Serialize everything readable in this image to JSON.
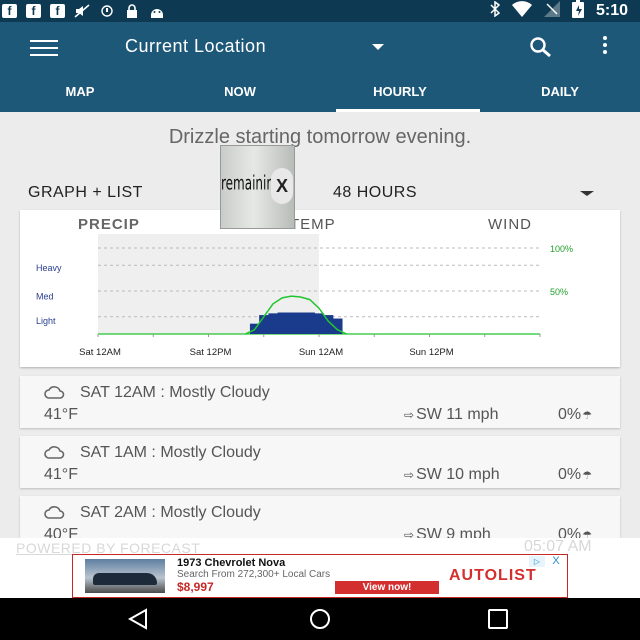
{
  "status_bar": {
    "time": "5:10",
    "left_icons": [
      "facebook-icon",
      "facebook-icon",
      "facebook-icon",
      "no-sound-icon",
      "sync-icon",
      "lock-icon",
      "android-debug-icon"
    ],
    "right_icons": [
      "bluetooth-icon",
      "wifi-icon",
      "signal-icon",
      "battery-charging-icon"
    ],
    "fb_letter": "f"
  },
  "app_bar": {
    "title": "Current Location",
    "tabs": [
      {
        "label": "MAP",
        "active": false
      },
      {
        "label": "NOW",
        "active": false
      },
      {
        "label": "HOURLY",
        "active": true
      },
      {
        "label": "DAILY",
        "active": false
      }
    ]
  },
  "summary": "Drizzle starting tomorrow evening.",
  "view_controls": {
    "mode": "GRAPH + LIST",
    "range": "48 HOURS"
  },
  "popup_ad": {
    "text": "remaining",
    "close": "X"
  },
  "chart_tabs": {
    "precip": "PRECIP",
    "temp": "TEMP",
    "wind": "WIND"
  },
  "chart_data": {
    "type": "area",
    "intensity_levels": [
      "Heavy",
      "Med",
      "Light"
    ],
    "x_ticks": [
      "Sat 12AM",
      "Sat 12PM",
      "Sun 12AM",
      "Sun 12PM"
    ],
    "right_axis_ticks": [
      "100%",
      "50%"
    ],
    "x_range_hours": [
      0,
      48
    ],
    "series": [
      {
        "kind": "intensity",
        "color": "#1a3a8c",
        "x": [
          17,
          18,
          19,
          20,
          21,
          22,
          23,
          24,
          25,
          26
        ],
        "values": [
          0.12,
          0.22,
          0.24,
          0.25,
          0.25,
          0.25,
          0.25,
          0.24,
          0.22,
          0.18
        ]
      },
      {
        "kind": "probability",
        "color": "#22c52e",
        "x": [
          16,
          17,
          18,
          19,
          20,
          21,
          22,
          23,
          24,
          25,
          26,
          27
        ],
        "values": [
          0,
          0.05,
          0.2,
          0.35,
          0.42,
          0.44,
          0.43,
          0.4,
          0.3,
          0.15,
          0.05,
          0
        ]
      }
    ],
    "shaded_region_hours": [
      0,
      24
    ],
    "colors": {
      "intensity": "#1a3a8c",
      "probability": "#22c52e",
      "shade": "#efefef"
    }
  },
  "hourly_rows": [
    {
      "title": "SAT 12AM : Mostly Cloudy",
      "temp": "41°F",
      "wind": "SW 11 mph",
      "pop": "0%"
    },
    {
      "title": "SAT 1AM : Mostly Cloudy",
      "temp": "41°F",
      "wind": "SW 10 mph",
      "pop": "0%"
    },
    {
      "title": "SAT 2AM : Mostly Cloudy",
      "temp": "40°F",
      "wind": "SW 9 mph",
      "pop": "0%"
    }
  ],
  "footer": {
    "powered": "POWERED BY FORECAST",
    "time": "05:07 AM"
  },
  "ad_banner": {
    "title": "1973 Chevrolet Nova",
    "desc": "Search From 272,300+ Local Cars",
    "price": "$8,997",
    "cta": "View now!",
    "brand": "AUTOLIST",
    "close": "X"
  },
  "nav_bar": {
    "buttons": [
      "back",
      "home",
      "recents"
    ]
  }
}
